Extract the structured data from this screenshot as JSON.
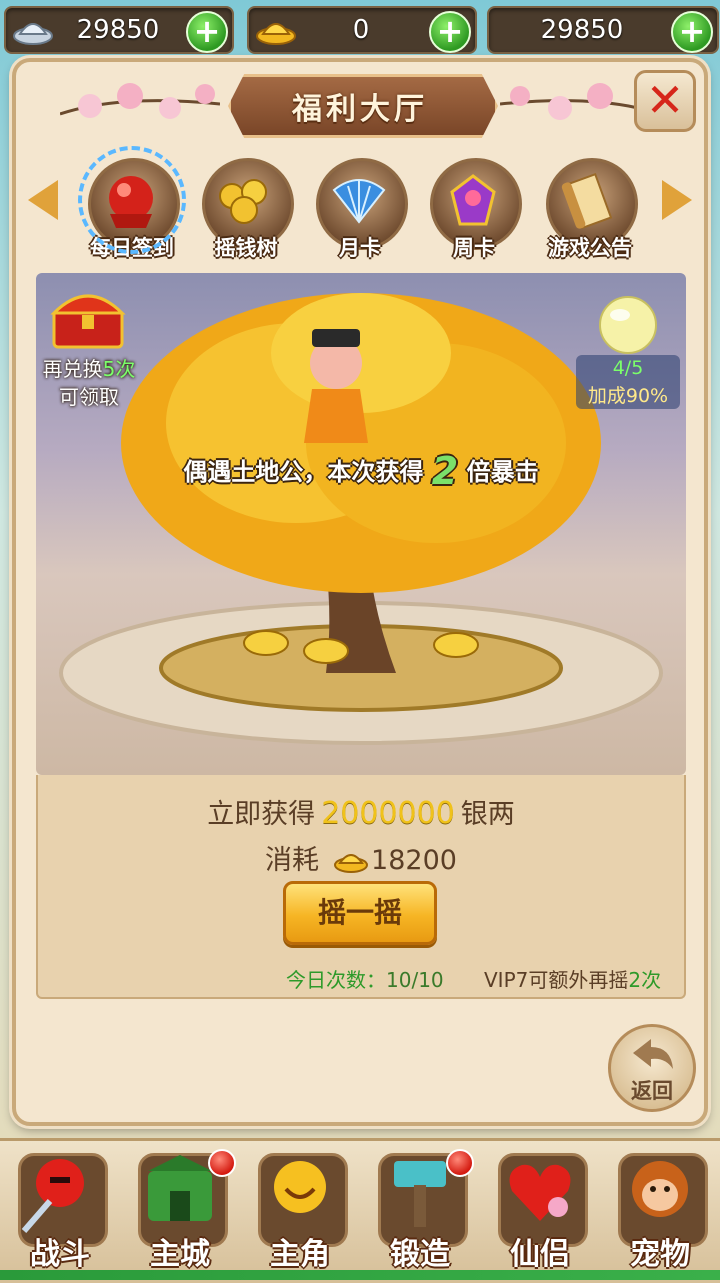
{
  "currencies": [
    {
      "name": "silver",
      "icon": "silver-ingot-icon",
      "value": "29850"
    },
    {
      "name": "gold",
      "icon": "gold-ingot-icon",
      "value": "0"
    },
    {
      "name": "third",
      "icon": "",
      "value": "29850"
    }
  ],
  "panel": {
    "title": "福利大厅",
    "close_icon": "close-icon"
  },
  "tabs": [
    {
      "label": "每日签到",
      "icon": "red-orb-icon",
      "selected": true
    },
    {
      "label": "摇钱树",
      "icon": "coin-pile-icon",
      "selected": false
    },
    {
      "label": "月卡",
      "icon": "blue-fan-icon",
      "selected": false
    },
    {
      "label": "周卡",
      "icon": "gem-badge-icon",
      "selected": false
    },
    {
      "label": "游戏公告",
      "icon": "scroll-icon",
      "selected": false
    }
  ],
  "scene": {
    "chest_label_prefix": "再兑换",
    "chest_count": "5次",
    "chest_label_line2": "可领取",
    "bonus_progress": "4/5",
    "bonus_text": "加成90%",
    "crit_prefix": "偶遇土地公，本次获得",
    "crit_multiplier": "2",
    "crit_suffix": "倍暴击"
  },
  "reward": {
    "gain_prefix": "立即获得",
    "gain_amount": "2000000",
    "gain_unit": "银两",
    "cost_label": "消耗",
    "cost_amount": "18200",
    "cost_icon": "gold-ingot-icon",
    "shake_button": "摇一摇",
    "today_label": "今日次数：",
    "today_value": "10/10",
    "vip_prefix": "VIP7可额外再摇",
    "vip_count": "2次"
  },
  "back": {
    "label": "返回",
    "icon": "back-arrow-icon"
  },
  "nav": [
    {
      "label": "战斗",
      "icon": "sword-fighter-icon",
      "badge": false
    },
    {
      "label": "主城",
      "icon": "city-gate-icon",
      "badge": true
    },
    {
      "label": "主角",
      "icon": "hero-face-icon",
      "badge": false
    },
    {
      "label": "锻造",
      "icon": "hammer-icon",
      "badge": true
    },
    {
      "label": "仙侣",
      "icon": "heart-icon",
      "badge": false
    },
    {
      "label": "宠物",
      "icon": "monkey-icon",
      "badge": false
    }
  ],
  "colors": {
    "accent_green": "#2e9a2a",
    "gold": "#f0c21a",
    "brown_text": "#5a3e26",
    "badge_red": "#d41a10"
  }
}
